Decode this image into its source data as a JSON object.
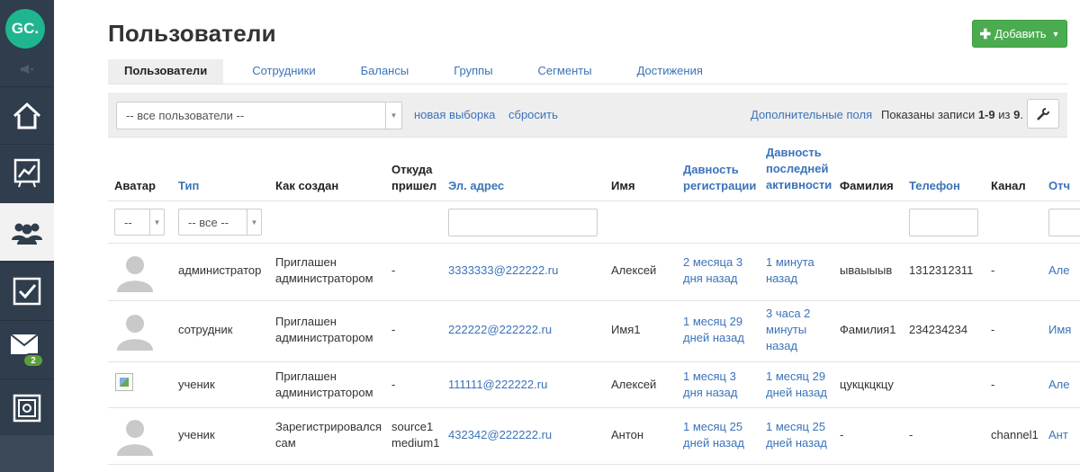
{
  "sidebar": {
    "logo": "GC.",
    "mail_badge": "2"
  },
  "header": {
    "title": "Пользователи",
    "add_button": "Добавить"
  },
  "tabs": [
    "Пользователи",
    "Сотрудники",
    "Балансы",
    "Группы",
    "Сегменты",
    "Достижения"
  ],
  "toolbar": {
    "select_value": "-- все пользователи --",
    "new_selection": "новая выборка",
    "reset": "сбросить",
    "extra_fields": "Дополнительные поля",
    "shown_prefix": "Показаны записи ",
    "shown_range": "1-9",
    "shown_mid": " из ",
    "shown_total": "9",
    "shown_suffix": "."
  },
  "table": {
    "headers": {
      "avatar": "Аватар",
      "type": "Тип",
      "created": "Как создан",
      "source_1": "Откуда",
      "source_2": "пришел",
      "email": "Эл. адрес",
      "name": "Имя",
      "reg_1": "Давность",
      "reg_2": "регистрации",
      "act_1": "Давность",
      "act_2": "последней",
      "act_3": "активности",
      "surname": "Фамилия",
      "phone": "Телефон",
      "channel": "Канал",
      "extra": "Отч"
    },
    "filters": {
      "avatar_select": "--",
      "type_select": "-- все --"
    },
    "rows": [
      {
        "type": "администратор",
        "created_1": "Приглашен",
        "created_2": "администратором",
        "source_1": "-",
        "source_2": "",
        "email": "3333333@222222.ru",
        "name": "Алексей",
        "reg_1": "2 месяца 3",
        "reg_2": "дня назад",
        "act_1": "1 минута",
        "act_2": "назад",
        "act_3": "",
        "surname": "ываыыыв",
        "phone": "1312312311",
        "channel": "-",
        "extra": "Але"
      },
      {
        "type": "сотрудник",
        "created_1": "Приглашен",
        "created_2": "администратором",
        "source_1": "-",
        "source_2": "",
        "email": "222222@222222.ru",
        "name": "Имя1",
        "reg_1": "1 месяц 29",
        "reg_2": "дней назад",
        "act_1": "3 часа 2",
        "act_2": "минуты",
        "act_3": "назад",
        "surname": "Фамилия1",
        "phone": "234234234",
        "channel": "-",
        "extra": "Имя"
      },
      {
        "type": "ученик",
        "created_1": "Приглашен",
        "created_2": "администратором",
        "source_1": "-",
        "source_2": "",
        "email": "111111@222222.ru",
        "name": "Алексей",
        "reg_1": "1 месяц 3",
        "reg_2": "дня назад",
        "act_1": "1 месяц 29",
        "act_2": "дней назад",
        "act_3": "",
        "surname": "цукцкцкцу",
        "phone": "",
        "channel": "-",
        "extra": "Але"
      },
      {
        "type": "ученик",
        "created_1": "Зарегистрировался",
        "created_2": "сам",
        "source_1": "source1",
        "source_2": "medium1",
        "email": "432342@222222.ru",
        "name": "Антон",
        "reg_1": "1 месяц 25",
        "reg_2": "дней назад",
        "act_1": "1 месяц 25",
        "act_2": "дней назад",
        "act_3": "",
        "surname": "-",
        "phone": "-",
        "channel": "channel1",
        "extra": "Ант"
      }
    ]
  },
  "colors": {
    "sidebar": "#2f3d4c",
    "logo": "#1fb58f",
    "link": "#3b73b9",
    "add_button": "#4aab4f",
    "badge": "#5a9e3c"
  }
}
